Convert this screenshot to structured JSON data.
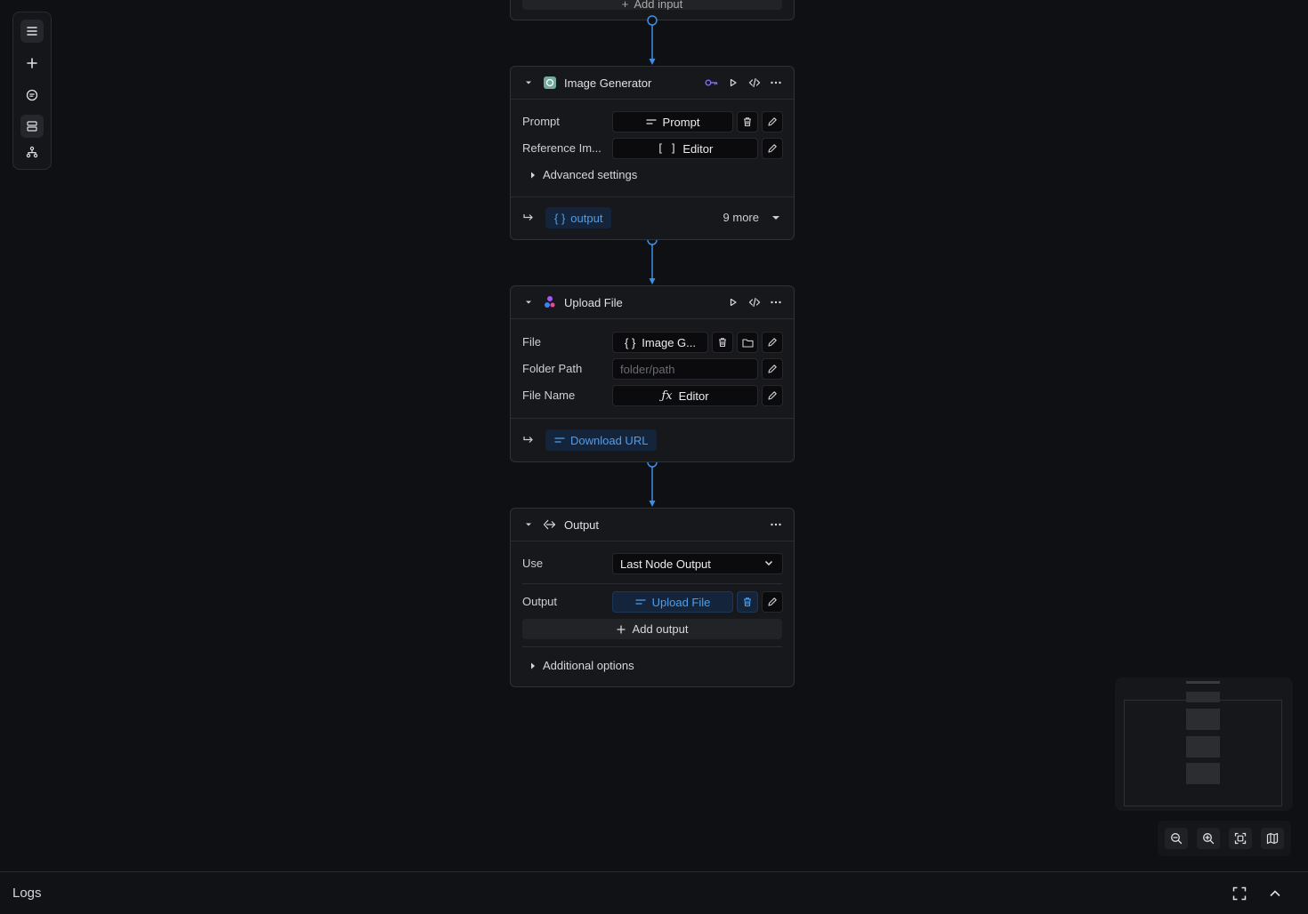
{
  "top_node": {
    "add_input_label": "Add input"
  },
  "image_generator": {
    "title": "Image Generator",
    "prompt_label": "Prompt",
    "prompt_value": "Prompt",
    "reference_label": "Reference Im...",
    "reference_value": "Editor",
    "advanced_label": "Advanced settings",
    "output_chip": "output",
    "more_label": "9 more"
  },
  "upload_file": {
    "title": "Upload File",
    "file_label": "File",
    "file_value": "Image G...",
    "folder_label": "Folder Path",
    "folder_placeholder": "folder/path",
    "filename_label": "File Name",
    "filename_value": "Editor",
    "output_chip": "Download URL"
  },
  "output_node": {
    "title": "Output",
    "use_label": "Use",
    "use_value": "Last Node Output",
    "output_label": "Output",
    "output_value": "Upload File",
    "add_output_label": "Add output",
    "additional_label": "Additional options"
  },
  "logs": {
    "title": "Logs"
  },
  "colors": {
    "accent": "#4d9df0",
    "background": "#0f1013",
    "node": "#17181b"
  },
  "icons": [
    "menu-icon",
    "plus-icon",
    "chat-icon",
    "layers-icon",
    "hierarchy-icon",
    "key-icon",
    "play-icon",
    "code-icon",
    "more-icon",
    "trash-icon",
    "pencil-icon",
    "folder-icon",
    "zoom-out-icon",
    "zoom-in-icon",
    "fit-view-icon",
    "map-icon",
    "expand-icon",
    "chevron-up-icon"
  ]
}
